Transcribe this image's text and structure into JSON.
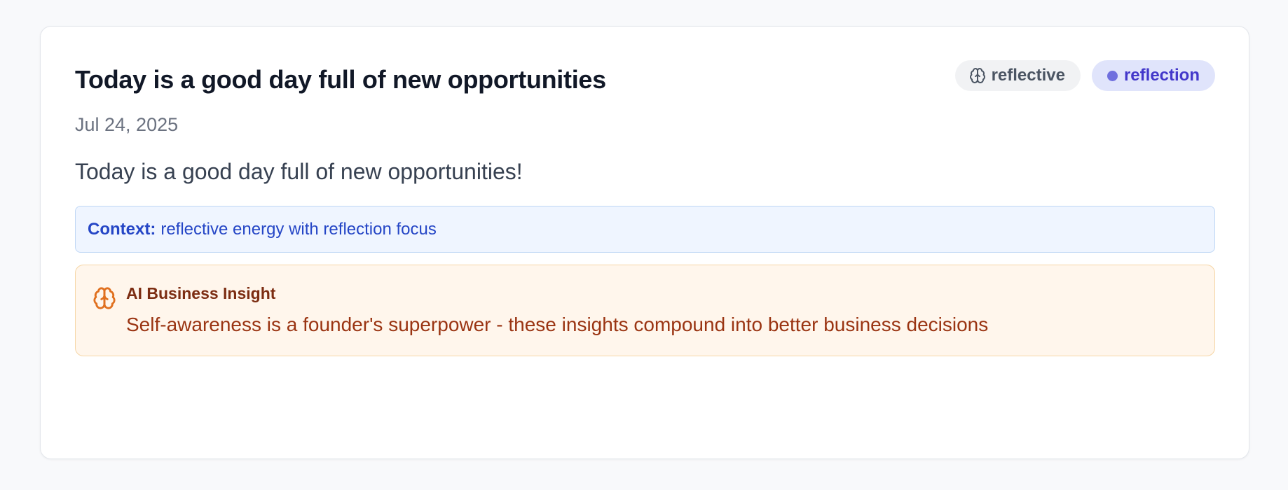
{
  "entry": {
    "title": "Today is a good day full of new opportunities",
    "date": "Jul 24, 2025",
    "content": "Today is a good day full of new opportunities!",
    "badges": {
      "mood": {
        "label": "reflective",
        "icon": "brain-icon"
      },
      "focus": {
        "label": "reflection",
        "dot_color": "#6f6fde"
      }
    },
    "context": {
      "label": "Context:",
      "text": "reflective energy with reflection focus"
    },
    "insight": {
      "icon": "brain-icon",
      "title": "AI Business Insight",
      "text": "Self-awareness is a founder's superpower - these insights compound into better business decisions"
    }
  },
  "colors": {
    "page_background": "#f8f9fb",
    "title": "#111827",
    "context_background": "#eff5ff",
    "context_text": "#2546c6",
    "insight_background": "#fff6ec",
    "insight_text": "#9a3412",
    "focus_badge_background": "#e0e4fb",
    "focus_badge_text": "#4338ca"
  }
}
